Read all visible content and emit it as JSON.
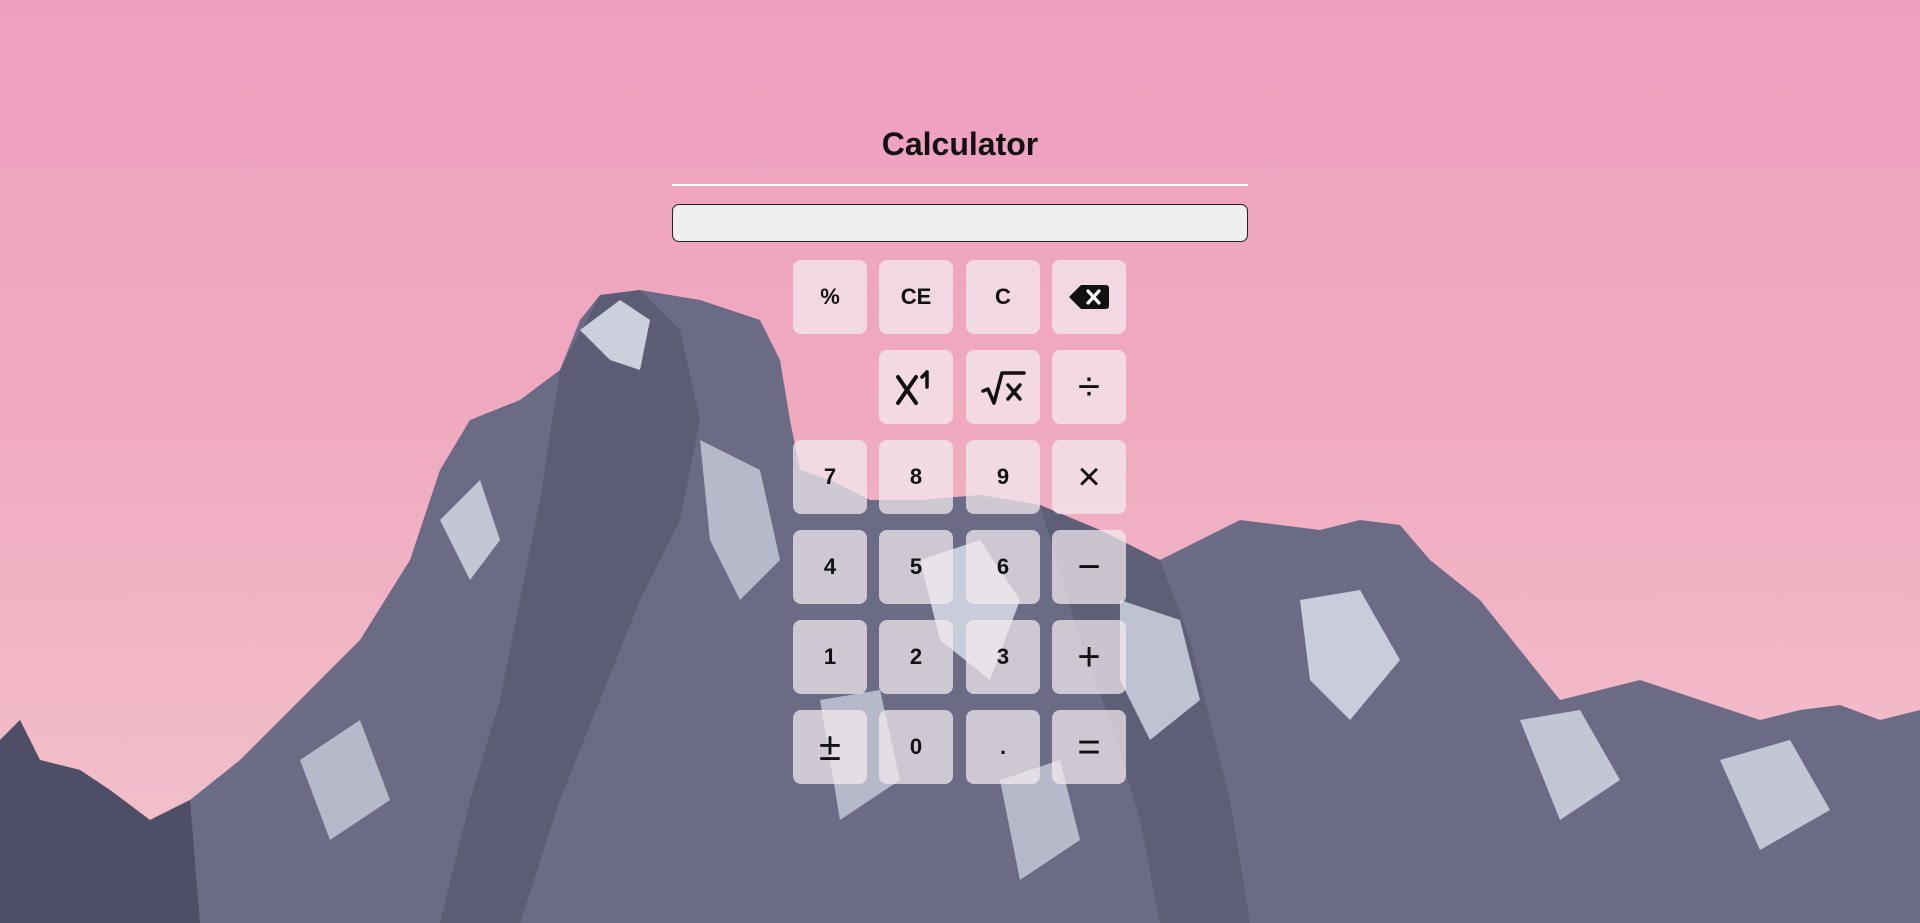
{
  "calculator": {
    "title": "Calculator",
    "display_value": "",
    "keys": {
      "percent": "%",
      "clear_entry": "CE",
      "clear": "C",
      "backspace_icon": "backspace-icon",
      "power_icon": "x-superscript-icon",
      "sqrt_icon": "square-root-icon",
      "divide": "÷",
      "seven": "7",
      "eight": "8",
      "nine": "9",
      "multiply": "×",
      "four": "4",
      "five": "5",
      "six": "6",
      "subtract": "−",
      "one": "1",
      "two": "2",
      "three": "3",
      "add": "+",
      "negate": "±",
      "zero": "0",
      "decimal": ".",
      "equals": "="
    }
  },
  "colors": {
    "sky_top": "#ee9fc0",
    "sky_bottom": "#f3c4cd",
    "mountain": "#6f6f8a",
    "snow": "#e8ecf6",
    "key_bg": "#f2ecee",
    "display_bg": "#efefef"
  }
}
